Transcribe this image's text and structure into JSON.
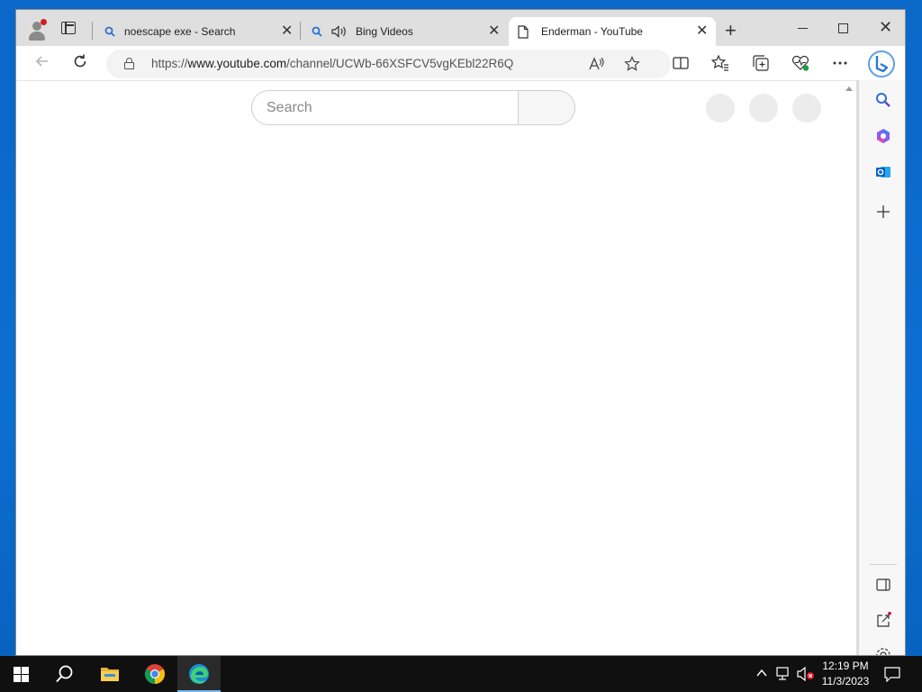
{
  "browser": {
    "tabs": [
      {
        "label": "noescape exe - Search",
        "icon": "search-icon"
      },
      {
        "label": "Bing Videos",
        "icon": "speaker-icon"
      },
      {
        "label": "Enderman - YouTube",
        "icon": "page-icon",
        "active": true
      }
    ],
    "close_glyph": "✕",
    "new_tab_glyph": "+",
    "address": {
      "prefix": "https://",
      "host": "www.youtube.com",
      "path": "/channel/UCWb-66XSFCV5vgKEbl22R6Q"
    },
    "accent": "#2b7ad8"
  },
  "page": {
    "search_placeholder": "Search"
  },
  "sidebar": {
    "items": [
      "search-icon",
      "copilot-icon",
      "outlook-icon",
      "add-icon",
      "split-icon",
      "external-link-icon",
      "settings-icon"
    ]
  },
  "taskbar": {
    "time": "12:19 PM",
    "date": "11/3/2023",
    "apps": [
      "start-icon",
      "search-icon",
      "file-explorer-icon",
      "chrome-icon",
      "edge-icon"
    ]
  }
}
